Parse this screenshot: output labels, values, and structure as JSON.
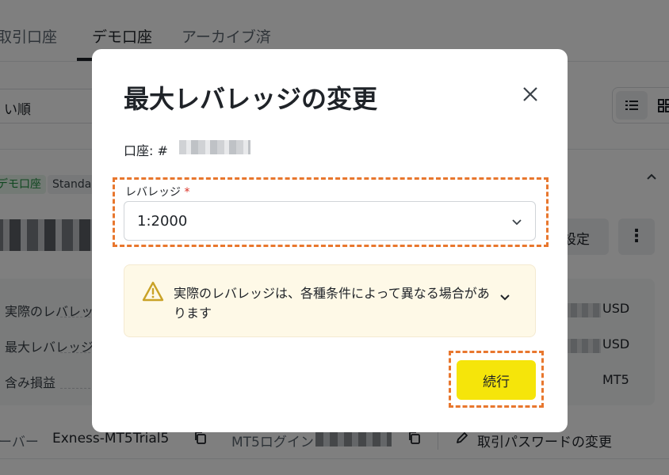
{
  "tabs": [
    {
      "label": "取引口座"
    },
    {
      "label": "デモ口座"
    },
    {
      "label": "アーカイブ済"
    }
  ],
  "sort": {
    "label": "い順"
  },
  "account_card": {
    "badge_demo": "デモ口座",
    "badge_standard": "Standa",
    "settings_label": "設定",
    "more_label": "⋮"
  },
  "info_rows": [
    {
      "label": "実際のレバレッジ",
      "value": "USD"
    },
    {
      "label": "最大レバレッジ",
      "value": "USD"
    },
    {
      "label": "含み損益",
      "value": "MT5"
    }
  ],
  "bottom_bar": {
    "server_label": "ーバー",
    "server_value": "Exness-MT5Trial5",
    "login_label": "MT5ログイン",
    "password_label": "取引パスワードの変更"
  },
  "modal": {
    "title": "最大レバレッジの変更",
    "account_prefix": "口座: #",
    "field_label": "レバレッジ",
    "required_mark": "*",
    "selected_leverage": "1:2000",
    "warning_text": "実際のレバレッジは、各種条件によって異なる場合があります",
    "continue_label": "続行"
  },
  "colors": {
    "highlight": "#e8772e",
    "primary_button": "#f5e50a",
    "warning_bg": "#fef9e7",
    "warning_icon": "#c9a227"
  }
}
